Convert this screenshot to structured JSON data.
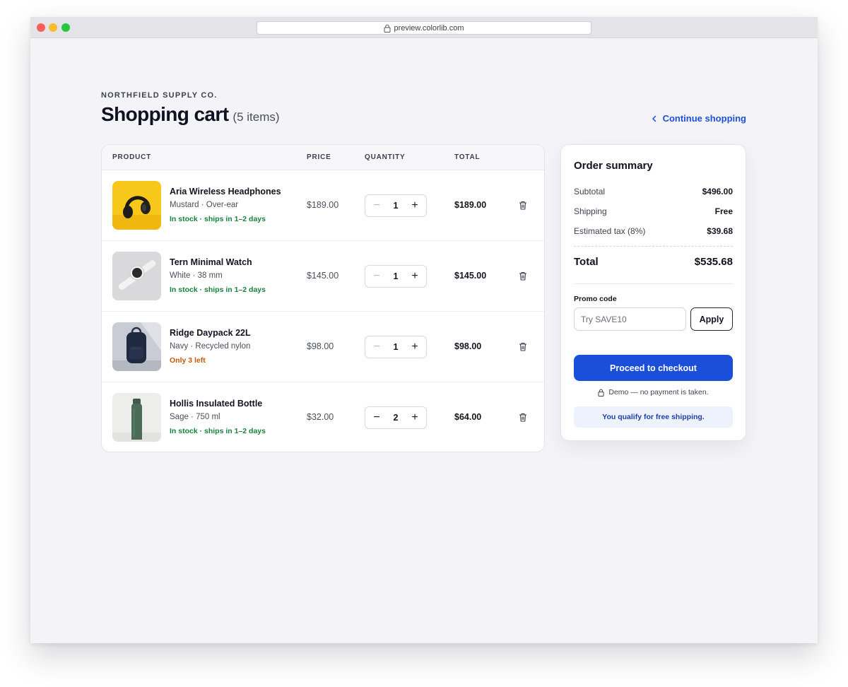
{
  "browser": {
    "url": "preview.colorlib.com"
  },
  "header": {
    "brand": "NORTHFIELD SUPPLY CO.",
    "title": "Shopping cart",
    "item_count": "(5 items)",
    "continue_label": "Continue shopping"
  },
  "cart": {
    "columns": [
      "PRODUCT",
      "PRICE",
      "QUANTITY",
      "TOTAL"
    ],
    "items": [
      {
        "name": "Aria Wireless Headphones",
        "variant": "Mustard · Over-ear",
        "stock": "In stock · ships in 1–2 days",
        "stock_status": "in-stock",
        "price": "$189.00",
        "quantity": "1",
        "total": "$189.00",
        "image": "headphones-photo"
      },
      {
        "name": "Tern Minimal Watch",
        "variant": "White · 38 mm",
        "stock": "In stock · ships in 1–2 days",
        "stock_status": "in-stock",
        "price": "$145.00",
        "quantity": "1",
        "total": "$145.00",
        "image": "watch-photo"
      },
      {
        "name": "Ridge Daypack 22L",
        "variant": "Navy · Recycled nylon",
        "stock": "Only 3 left",
        "stock_status": "low-stock",
        "price": "$98.00",
        "quantity": "1",
        "total": "$98.00",
        "image": "backpack-photo"
      },
      {
        "name": "Hollis Insulated Bottle",
        "variant": "Sage · 750 ml",
        "stock": "In stock · ships in 1–2 days",
        "stock_status": "in-stock",
        "price": "$32.00",
        "quantity": "2",
        "total": "$64.00",
        "image": "bottle-photo"
      }
    ]
  },
  "summary": {
    "title": "Order summary",
    "subtotal_label": "Subtotal",
    "subtotal": "$496.00",
    "shipping_label": "Shipping",
    "shipping": "Free",
    "tax_label": "Estimated tax (8%)",
    "tax": "$39.68",
    "total_label": "Total",
    "total": "$535.68",
    "promo_label": "Promo code",
    "promo_placeholder": "Try SAVE10",
    "apply_label": "Apply",
    "checkout_label": "Proceed to checkout",
    "demo_note": "Demo — no payment is taken.",
    "free_shipping_note": "You qualify for free shipping."
  },
  "colors": {
    "accent": "#1c4fd9",
    "in_stock": "#18823e",
    "low_stock": "#c35a00",
    "page_bg": "#f4f4f8"
  }
}
